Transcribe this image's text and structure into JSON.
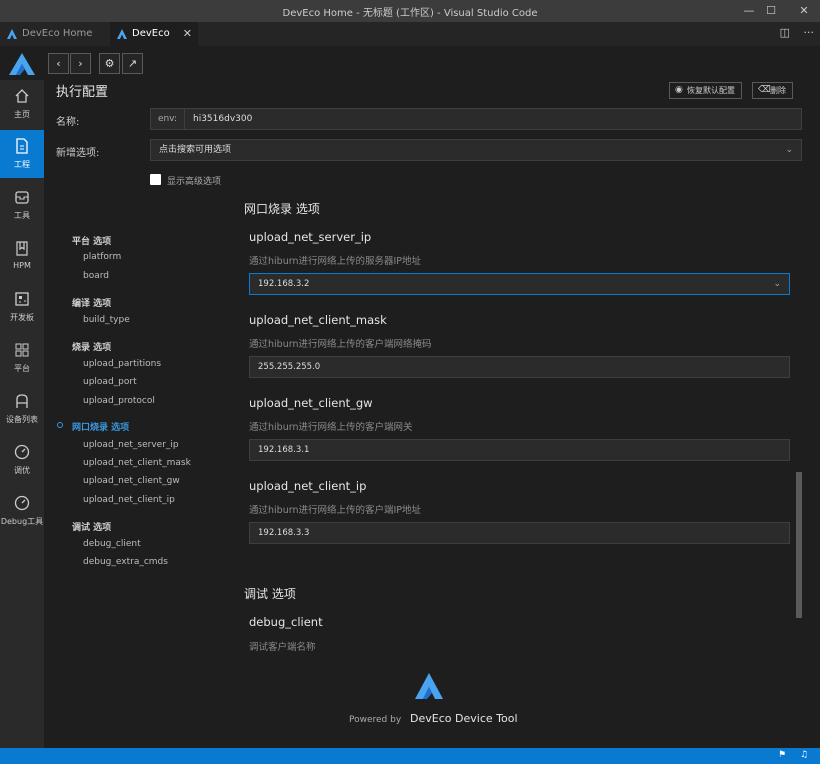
{
  "window": {
    "title": "DevEco Home - 无标题 (工作区) - Visual Studio Code"
  },
  "tabs": [
    {
      "label": "DevEco Home"
    },
    {
      "label": "DevEco Home"
    }
  ],
  "activity": [
    {
      "label": "主页",
      "icon": "home-icon"
    },
    {
      "label": "工程",
      "icon": "project-file-icon"
    },
    {
      "label": "工具",
      "icon": "tools-box-icon"
    },
    {
      "label": "HPM",
      "icon": "book-icon"
    },
    {
      "label": "开发板",
      "icon": "board-icon"
    },
    {
      "label": "平台",
      "icon": "grid-icon"
    },
    {
      "label": "设备列表",
      "icon": "device-icon"
    },
    {
      "label": "调优",
      "icon": "gauge-icon"
    },
    {
      "label": "Debug工具",
      "icon": "debug-gauge-icon"
    }
  ],
  "header": {
    "title": "执行配置",
    "restore_label": "恢复默认配置",
    "delete_label": "删除"
  },
  "form": {
    "name_label": "名称:",
    "name_prefix": "env:",
    "name_value": "hi3516dv300",
    "add_option_label": "新增选项:",
    "add_option_placeholder": "点击搜索可用选项",
    "advanced_label": "显示高级选项"
  },
  "toc": {
    "groups": [
      {
        "label": "平台 选项",
        "items": [
          "platform",
          "board"
        ]
      },
      {
        "label": "编译 选项",
        "items": [
          "build_type"
        ]
      },
      {
        "label": "烧录 选项",
        "items": [
          "upload_partitions",
          "upload_port",
          "upload_protocol"
        ]
      },
      {
        "label": "网口烧录 选项",
        "items": [
          "upload_net_server_ip",
          "upload_net_client_mask",
          "upload_net_client_gw",
          "upload_net_client_ip"
        ]
      },
      {
        "label": "调试 选项",
        "items": [
          "debug_client",
          "debug_extra_cmds"
        ]
      }
    ]
  },
  "sections": {
    "net_upload_title": "网口烧录 选项",
    "debug_title": "调试 选项"
  },
  "params": [
    {
      "name": "upload_net_server_ip",
      "desc": "通过hiburn进行网络上传的服务器IP地址",
      "value": "192.168.3.2"
    },
    {
      "name": "upload_net_client_mask",
      "desc": "通过hiburn进行网络上传的客户端网络掩码",
      "value": "255.255.255.0"
    },
    {
      "name": "upload_net_client_gw",
      "desc": "通过hiburn进行网络上传的客户端网关",
      "value": "192.168.3.1"
    },
    {
      "name": "upload_net_client_ip",
      "desc": "通过hiburn进行网络上传的客户端IP地址",
      "value": "192.168.3.3"
    },
    {
      "name": "debug_client",
      "desc": "调试客户端名称"
    }
  ],
  "footer": {
    "powered_by": "Powered by",
    "brand": "DevEco Device Tool"
  },
  "colors": {
    "accent": "#0a7ad1",
    "toc_active": "#3a96dd",
    "logo_light": "#5ab4f5",
    "logo_dark": "#1f6fd1"
  }
}
